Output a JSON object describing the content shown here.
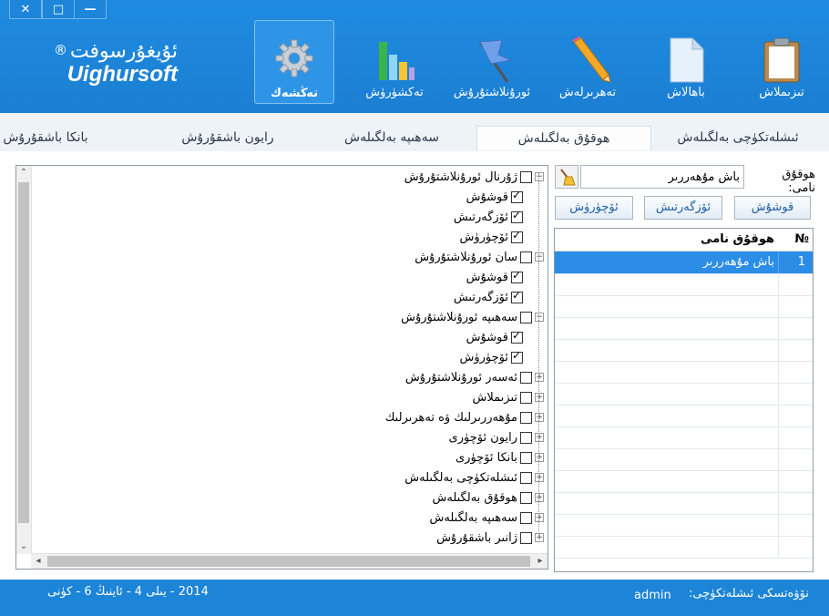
{
  "window": {
    "close": "✕",
    "restore": "□",
    "minimize": "—"
  },
  "brand": {
    "name_ug": "ئۇيغۇرسوفت",
    "name_en": "Uighursoft",
    "reg": "®"
  },
  "toolbar": [
    {
      "label": "تىزىملاش",
      "icon": "clipboard-icon"
    },
    {
      "label": "باھالاش",
      "icon": "document-icon"
    },
    {
      "label": "تەھرىرلەش",
      "icon": "pencil-icon"
    },
    {
      "label": "ئورۇنلاشتۇرۇش",
      "icon": "flag-icon"
    },
    {
      "label": "تەكشۈرۈش",
      "icon": "bar-chart-icon"
    },
    {
      "label": "تەڭشەك",
      "icon": "gear-icon"
    }
  ],
  "tabs": [
    "ئىشلەتكۈچى بەلگىلەش",
    "ھوقۇق بەلگىلەش",
    "سەھىپە بەلگىلەش",
    "رايون باشقۇرۇش",
    "بانكا باشقۇرۇش"
  ],
  "tree": [
    {
      "label": "ژۇرنال ئورۇنلاشتۇرۇش",
      "level": 0,
      "checked": false,
      "expander": "−"
    },
    {
      "label": "قوشۇش",
      "level": 1,
      "checked": true
    },
    {
      "label": "ئۆزگەرتىش",
      "level": 1,
      "checked": true
    },
    {
      "label": "ئۆچۈرۈش",
      "level": 1,
      "checked": true
    },
    {
      "label": "سان ئورۇنلاشتۇرۇش",
      "level": 0,
      "checked": false,
      "expander": "−"
    },
    {
      "label": "قوشۇش",
      "level": 1,
      "checked": true
    },
    {
      "label": "ئۆزگەرتىش",
      "level": 1,
      "checked": true
    },
    {
      "label": "سەھىپە ئورۇنلاشتۇرۇش",
      "level": 0,
      "checked": false,
      "expander": "−"
    },
    {
      "label": "قوشۇش",
      "level": 1,
      "checked": true
    },
    {
      "label": "ئۆچۈرۈش",
      "level": 1,
      "checked": true
    },
    {
      "label": "ئەسەر ئورۇنلاشتۇرۇش",
      "level": 0,
      "checked": false,
      "expander": "+"
    },
    {
      "label": "تىزىملاش",
      "level": 0,
      "checked": false,
      "expander": "+"
    },
    {
      "label": "مۇھەررىرلىك ۋە تەھرىرلىك",
      "level": 0,
      "checked": false,
      "expander": "+"
    },
    {
      "label": "رايون ئۆچۈرى",
      "level": 0,
      "checked": false,
      "expander": "+"
    },
    {
      "label": "بانكا ئۆچۈرى",
      "level": 0,
      "checked": false,
      "expander": "+"
    },
    {
      "label": "ئىشلەتكۈچى بەلگىلەش",
      "level": 0,
      "checked": false,
      "expander": "+"
    },
    {
      "label": "ھوقۇق بەلگىلەش",
      "level": 0,
      "checked": false,
      "expander": "+"
    },
    {
      "label": "سەھىپە بەلگىلەش",
      "level": 0,
      "checked": false,
      "expander": "+"
    },
    {
      "label": "ژانىر باشقۇرۇش",
      "level": 0,
      "checked": false,
      "expander": "+"
    }
  ],
  "right": {
    "field_label": "ھوقۇق نامى:",
    "field_value": "باش مۇھەررىر",
    "buttons": [
      "قوشۇش",
      "ئۆزگەرتىش",
      "ئۆچۈرۈش"
    ],
    "grid_headers": {
      "no": "№",
      "name": "ھوقۇق نامى"
    },
    "grid_rows": [
      {
        "no": "1",
        "name": "باش مۇھەررىر",
        "selected": true
      }
    ]
  },
  "status": {
    "user_label": "نۆۋەتسكى ئىشلەتكۈچى:",
    "user": "admin",
    "date": "2014 - يىلى 4 - ئاينىڭ 6 - كۈنى"
  },
  "colors": {
    "accent": "#1b7fd3",
    "selection": "#2b8de6"
  }
}
